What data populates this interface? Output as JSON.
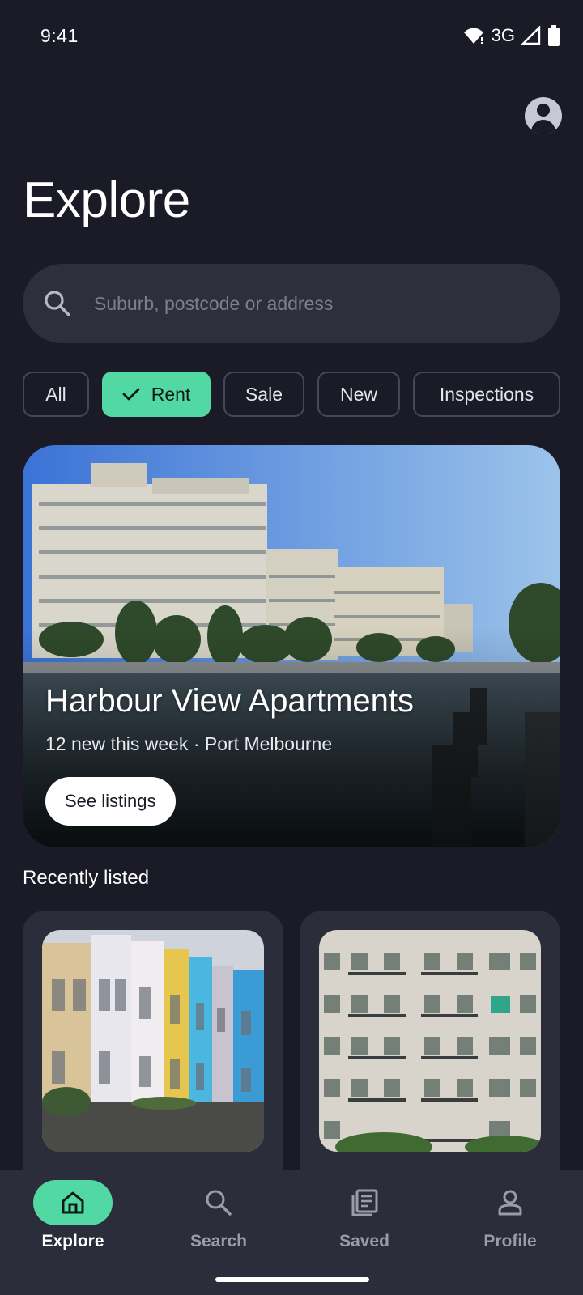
{
  "status_bar": {
    "time": "9:41",
    "network": "3G"
  },
  "header": {
    "title": "Explore"
  },
  "search": {
    "placeholder": "Suburb, postcode or address"
  },
  "filters": [
    {
      "label": "All",
      "selected": false
    },
    {
      "label": "Rent",
      "selected": true
    },
    {
      "label": "Sale",
      "selected": false
    },
    {
      "label": "New",
      "selected": false
    },
    {
      "label": "Inspections",
      "selected": false
    }
  ],
  "hero": {
    "title": "Harbour View Apartments",
    "subtitle": "12 new this week · Port Melbourne",
    "cta_label": "See listings"
  },
  "recent": {
    "title": "Recently listed"
  },
  "bottom_nav": [
    {
      "label": "Explore",
      "icon": "home-icon",
      "active": true
    },
    {
      "label": "Search",
      "icon": "search-icon",
      "active": false
    },
    {
      "label": "Saved",
      "icon": "saved-icon",
      "active": false
    },
    {
      "label": "Profile",
      "icon": "person-icon",
      "active": false
    }
  ],
  "colors": {
    "accent": "#52d9a3",
    "background": "#1a1b26",
    "surface": "#2b2e3a"
  }
}
